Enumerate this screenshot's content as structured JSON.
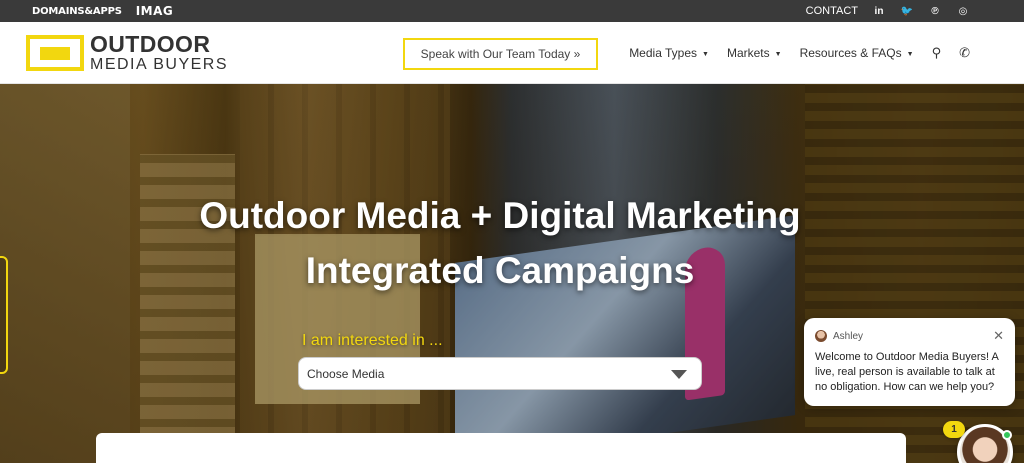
{
  "topbar": {
    "brand_domains_apps": "DOMAINS&APPS",
    "brand_imag": "IMAG",
    "contact": "CONTACT",
    "social": [
      {
        "name": "linkedin-icon",
        "glyph": "in"
      },
      {
        "name": "twitter-icon",
        "glyph": "🐦"
      },
      {
        "name": "pinterest-icon",
        "glyph": "℗"
      },
      {
        "name": "instagram-icon",
        "glyph": "◎"
      }
    ]
  },
  "header": {
    "logo_line1": "OUTDOOR",
    "logo_line2": "MEDIA BUYERS",
    "cta_label": "Speak with Our Team Today »",
    "nav": [
      {
        "label": "Media Types",
        "caret": "▼"
      },
      {
        "label": "Markets",
        "caret": "▼"
      },
      {
        "label": "Resources & FAQs",
        "caret": "▼"
      }
    ],
    "search_glyph": "⚲",
    "phone_glyph": "✆"
  },
  "hero": {
    "title_line1": "Outdoor Media + Digital Marketing",
    "title_line2": "Integrated Campaigns",
    "interest_label": "I am interested in ...",
    "select_value": "Choose Media"
  },
  "chat": {
    "agent_name": "Ashley",
    "close_glyph": "✕",
    "message": "Welcome to Outdoor Media Buyers! A live, real person is available to talk at no obligation. How can we help you?",
    "unread_count": "1"
  },
  "colors": {
    "accent_yellow": "#f2d70f",
    "topbar_bg": "#3a3a3a",
    "online_green": "#35c65c"
  }
}
